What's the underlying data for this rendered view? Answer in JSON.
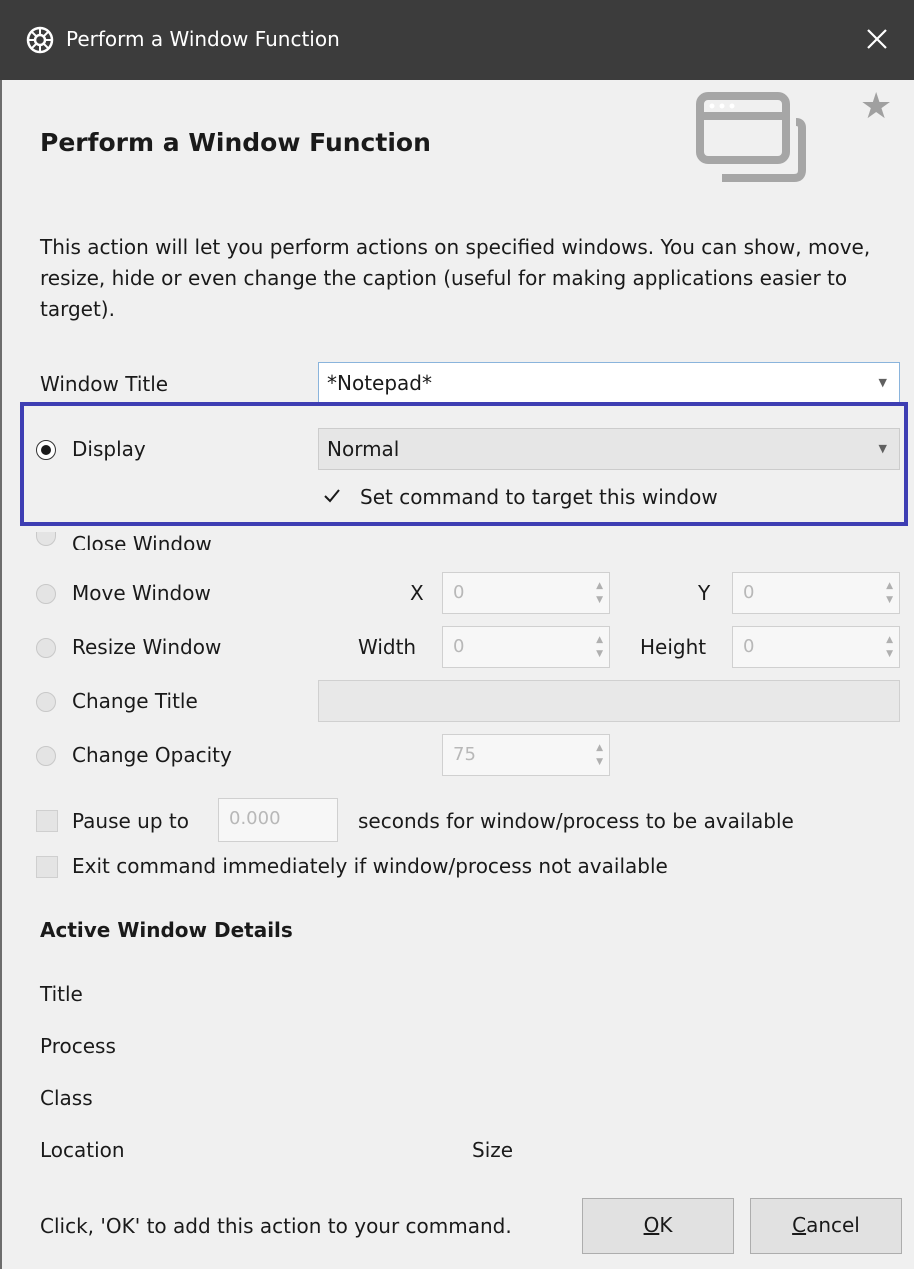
{
  "window": {
    "title": "Perform a Window Function",
    "app_icon": "gear-icon",
    "close_icon": "close-icon"
  },
  "header": {
    "heading": "Perform a Window Function",
    "illustration_icon": "window-icon",
    "favorite_icon": "star-icon",
    "favorite_glyph": "★"
  },
  "description": "This action will let you perform actions on specified windows.  You can show, move, resize, hide or even change the caption (useful for making applications easier to target).",
  "window_title": {
    "label": "Window Title",
    "value": "*Notepad*"
  },
  "options": {
    "display": {
      "label": "Display",
      "selected": true,
      "value": "Normal"
    },
    "set_command": {
      "label": "Set command to target this window",
      "checked": true
    },
    "close_window": {
      "label": "Close Window",
      "selected": false
    },
    "move_window": {
      "label": "Move Window",
      "selected": false,
      "x_label": "X",
      "x_value": "0",
      "y_label": "Y",
      "y_value": "0"
    },
    "resize_window": {
      "label": "Resize Window",
      "selected": false,
      "width_label": "Width",
      "width_value": "0",
      "height_label": "Height",
      "height_value": "0"
    },
    "change_title": {
      "label": "Change Title",
      "selected": false,
      "value": ""
    },
    "change_opacity": {
      "label": "Change Opacity",
      "selected": false,
      "value": "75"
    }
  },
  "pause": {
    "label_before": "Pause up to",
    "value": "0.000",
    "label_after": "seconds for window/process to be available",
    "checked": false
  },
  "exit_if_unavailable": {
    "label": "Exit command immediately if window/process not available",
    "checked": false
  },
  "active_details": {
    "heading": "Active Window Details",
    "title_label": "Title",
    "process_label": "Process",
    "class_label": "Class",
    "location_label": "Location",
    "size_label": "Size"
  },
  "footer": {
    "hint": "Click, 'OK' to add this action to your command.",
    "ok_mnemonic": "O",
    "ok_rest": "K",
    "cancel_mnemonic": "C",
    "cancel_rest": "ancel"
  },
  "colors": {
    "titlebar": "#3c3c3c",
    "highlight": "#3e3eb3",
    "background": "#f0f0f0"
  }
}
